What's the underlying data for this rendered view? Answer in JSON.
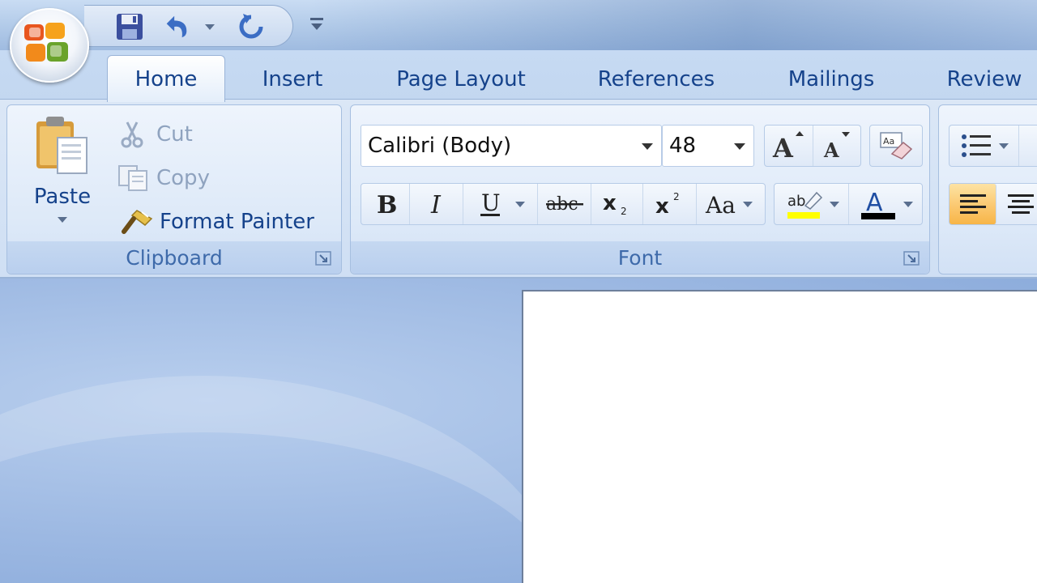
{
  "quick_access": {
    "save_icon": "save-icon",
    "undo_icon": "undo-icon",
    "redo_icon": "redo-icon",
    "customize_icon": "customize-qat-icon"
  },
  "tabs": [
    {
      "label": "Home",
      "active": true
    },
    {
      "label": "Insert",
      "active": false
    },
    {
      "label": "Page Layout",
      "active": false
    },
    {
      "label": "References",
      "active": false
    },
    {
      "label": "Mailings",
      "active": false
    },
    {
      "label": "Review",
      "active": false
    }
  ],
  "clipboard": {
    "paste_label": "Paste",
    "cut_label": "Cut",
    "copy_label": "Copy",
    "format_painter_label": "Format Painter",
    "group_label": "Clipboard"
  },
  "font": {
    "font_name": "Calibri (Body)",
    "font_size": "48",
    "group_label": "Font",
    "highlight_color": "#ffff00",
    "font_color": "#000000"
  },
  "colors": {
    "accent": "#15428b",
    "ribbon": "#dbe7f6",
    "active_align": "#fbc66b"
  }
}
